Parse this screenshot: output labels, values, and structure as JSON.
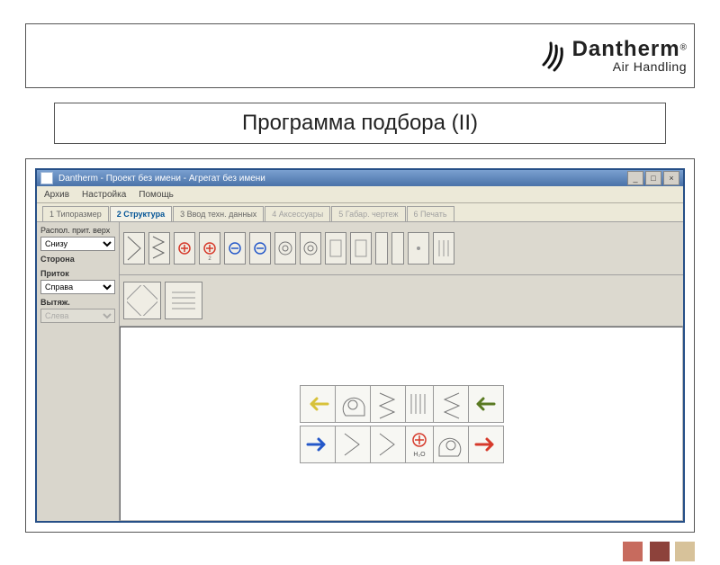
{
  "brand": {
    "name": "Dantherm",
    "subline": "Air Handling",
    "reg": "®"
  },
  "title": "Программа подбора (II)",
  "app": {
    "window_title": "Dantherm - Проект без имени - Агрегат без имени",
    "menus": [
      "Архив",
      "Настройка",
      "Помощь"
    ],
    "tabs": [
      {
        "label": "1 Типоразмер",
        "active": false,
        "disabled": false
      },
      {
        "label": "2 Структура",
        "active": true,
        "disabled": false
      },
      {
        "label": "3 Ввод техн. данных",
        "active": false,
        "disabled": false
      },
      {
        "label": "4 Аксессуары",
        "active": false,
        "disabled": true
      },
      {
        "label": "5 Габар. чертеж",
        "active": false,
        "disabled": true
      },
      {
        "label": "6 Печать",
        "active": false,
        "disabled": true
      }
    ],
    "sidebar": {
      "section1_label": "Распол. прит. верх",
      "section1_value": "Снизу",
      "section2_label": "Сторона",
      "pritok_label": "Приток",
      "pritok_value": "Справа",
      "vyt_label": "Вытяж.",
      "vyt_value": "Слева"
    },
    "palette_icons": [
      "filter-a",
      "filter-b",
      "heater-red",
      "heater-red-2",
      "cooler-blue",
      "cooler-blue-2",
      "fan",
      "fan-2",
      "damper",
      "sound",
      "blank",
      "blank",
      "humid",
      "mix"
    ],
    "palette2_icons": [
      "rotary-hex",
      "plate-hex"
    ],
    "unit": {
      "top_row": [
        "arrow-left-yellow",
        "fan",
        "filter",
        "heat-exchanger",
        "filter",
        "arrow-left-green"
      ],
      "bot_row": [
        "arrow-right-blue",
        "filter",
        "filter",
        "heater-h2o",
        "fan",
        "arrow-right-red"
      ],
      "heater_label": "H₂O"
    },
    "win_btns": [
      "_",
      "□",
      "×"
    ]
  },
  "colors": {
    "accent_red": "#d63a2b",
    "accent_blue": "#2458c9",
    "accent_green": "#5a7a22",
    "accent_yellow": "#d8c23a"
  }
}
